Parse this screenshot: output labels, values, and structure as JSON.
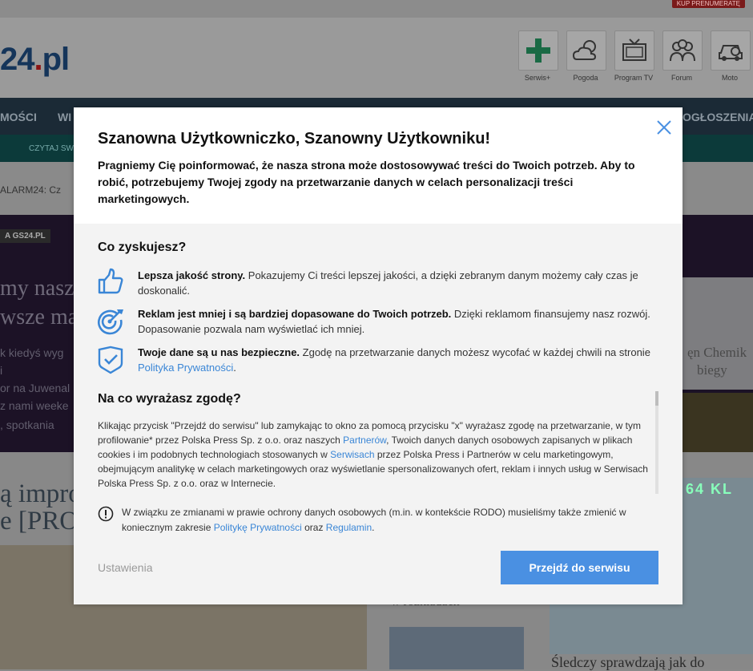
{
  "site": {
    "subscribe_label": "KUP PRENUMERATĘ",
    "logo_number": "24",
    "logo_dot": ".",
    "logo_tld": "pl",
    "header_icons": [
      {
        "label": "Serwis+",
        "icon": "plus-icon"
      },
      {
        "label": "Pogoda",
        "icon": "weather-icon"
      },
      {
        "label": "Program TV",
        "icon": "tv-icon"
      },
      {
        "label": "Forum",
        "icon": "forum-icon"
      },
      {
        "label": "Moto",
        "icon": "car-icon"
      }
    ],
    "nav": {
      "left1": "MOŚCI",
      "left2": "WI",
      "right": "OGŁOSZENIA"
    },
    "green_bar_text": "CZYTAJ SW",
    "alarm_text": "ALARM24: Cz",
    "hero_tag": "A GS24.PL",
    "hero_lines": [
      "my nasz",
      "wsze ma"
    ],
    "hero_sub": [
      "k kiedyś wyg",
      "i",
      "or na Juwenal",
      "z nami weeke",
      ", spotkania"
    ],
    "hero_img_lines": [
      "ęn Chemik",
      "biegy"
    ],
    "lower_headlines": [
      "ą impro",
      "e [PRO"
    ],
    "bus_number": "64 KL",
    "card_headline": "w rozkładach",
    "story_headline": "Śledczy sprawdzają jak do"
  },
  "modal": {
    "title": "Szanowna Użytkowniczko, Szanowny Użytkowniku!",
    "intro": "Pragniemy Cię poinformować, że nasza strona może dostosowywać treści do Twoich potrzeb. Aby to robić, potrzebujemy Twojej zgody na przetwarzanie danych w celach personalizacji treści marketingowych.",
    "benefits_title": "Co zyskujesz?",
    "benefits": [
      {
        "bold": "Lepsza jakość strony.",
        "text": " Pokazujemy Ci treści lepszej jakości, a dzięki zebranym danym możemy cały czas je doskonalić.",
        "icon": "thumbs-up-icon"
      },
      {
        "bold": "Reklam jest mniej i są bardziej dopasowane do Twoich potrzeb.",
        "text": " Dzięki reklamom finansujemy nasz rozwój. Dopasowanie pozwala nam wyświetlać ich mniej.",
        "icon": "target-icon"
      },
      {
        "bold": "Twoje dane są u nas bezpieczne.",
        "text": " Zgodę na przetwarzanie danych możesz wycofać w każdej chwili na stronie ",
        "link": "Polityka Prywatności",
        "after": ".",
        "icon": "shield-check-icon"
      }
    ],
    "consent_title": "Na co wyrażasz zgodę?",
    "consent": {
      "p1": "Klikając przycisk \"Przejdź do serwisu\" lub zamykając to okno za pomocą przycisku \"x\" wyrażasz zgodę na przetwarzanie, w tym profilowanie* przez Polska Press Sp. z o.o. oraz naszych ",
      "link1": "Partnerów",
      "p2": ", Twoich danych danych osobowych zapisanych w plikach cookies i im podobnych technologiach stosowanych w ",
      "link2": "Serwisach",
      "p3": " przez Polska Press i Partnerów w celu marketingowym, obejmującym analitykę w celach marketingowych oraz wyświetlanie spersonalizowanych ofert, reklam i innych usług w Serwisach Polska Press Sp. z o.o. oraz w Internecie."
    },
    "notice": {
      "p1": "W związku ze zmianami w prawie ochrony danych osobowych (m.in. w kontekście RODO) musieliśmy także zmienić w koniecznym zakresie ",
      "link1": "Politykę Prywatności",
      "mid": " oraz ",
      "link2": "Regulamin",
      "end": "."
    },
    "settings_label": "Ustawienia",
    "go_label": "Przejdź do serwisu",
    "accent_color": "#4a90e2",
    "link_color": "#3a86d6"
  }
}
